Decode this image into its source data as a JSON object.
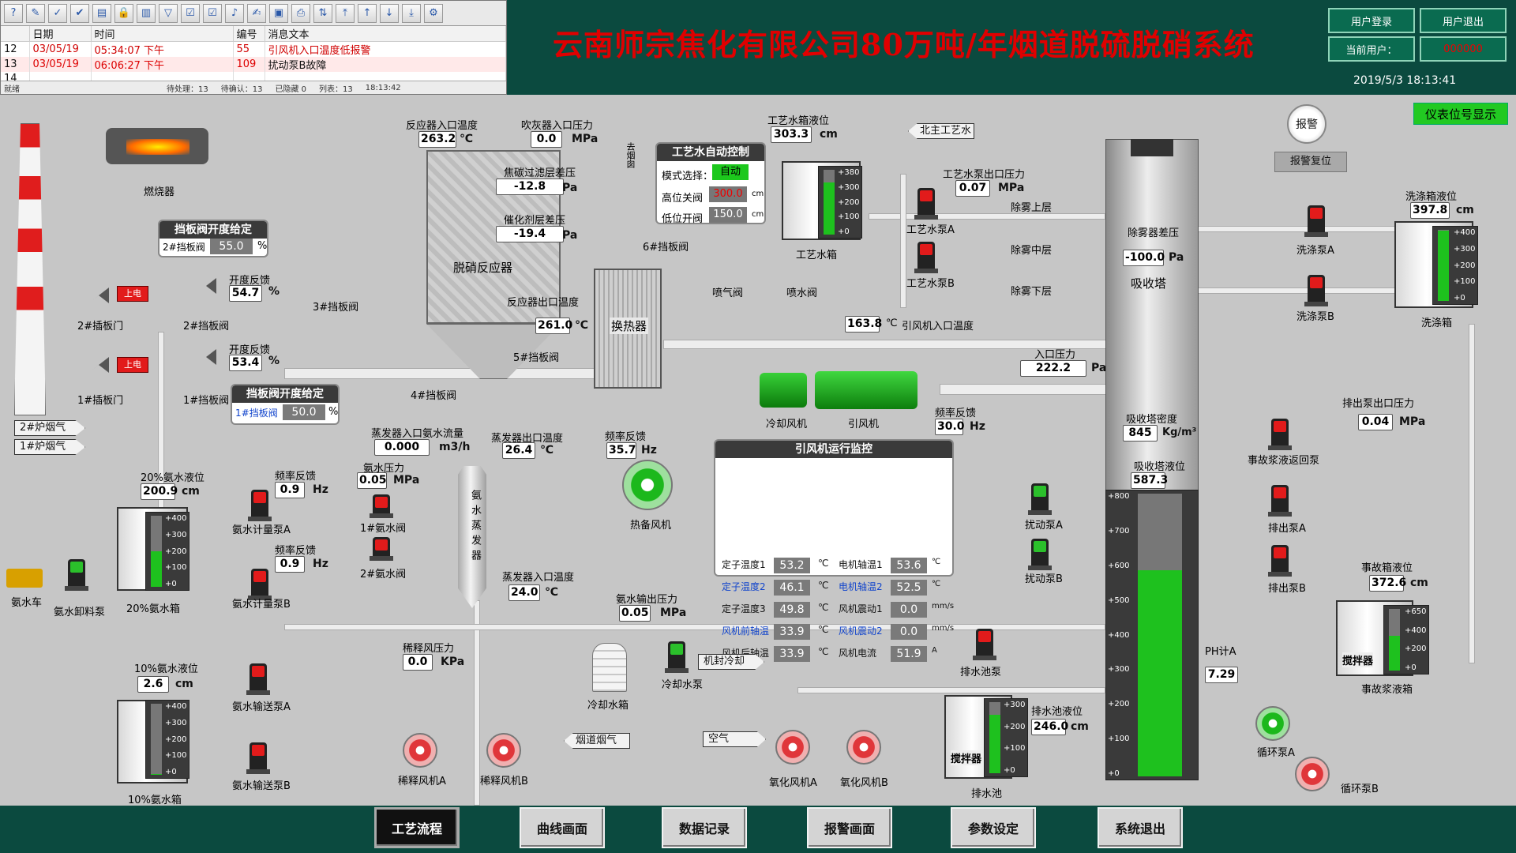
{
  "app": {
    "title": "云南师宗焦化有限公司80万吨/年烟道脱硫脱硝系统",
    "datetime": "2019/5/3 18:13:41",
    "login_label": "用户登录",
    "logout_label": "用户退出",
    "current_user_label": "当前用户：",
    "current_user_value": "000000",
    "instrument_btn": "仪表位号显示",
    "alarm_btn": "报警",
    "alarm_reset_btn": "报警复位"
  },
  "alarm_panel": {
    "columns": [
      "日期",
      "时间",
      "编号",
      "消息文本"
    ],
    "rows": [
      {
        "idx": "12",
        "date": "03/05/19",
        "time": "05:34:07 下午",
        "code": "55",
        "text": "引风机入口温度低报警"
      },
      {
        "idx": "13",
        "date": "03/05/19",
        "time": "06:06:27 下午",
        "code": "109",
        "text": "扰动泵B故障"
      },
      {
        "idx": "14",
        "date": "",
        "time": "",
        "code": "",
        "text": ""
      }
    ],
    "status_ready": "就绪",
    "status_pending": "待处理：13",
    "status_confirm": "待确认：13",
    "status_hidden": "已隐藏 0",
    "status_list": "列表：13",
    "status_time": "18:13:42"
  },
  "labels": {
    "burner": "燃烧器",
    "damper_panel_title": "挡板阀开度给定",
    "damper2_label": "2#挡板阀",
    "damper2_value": "55.0",
    "damper1_label": "1#挡板阀",
    "damper1_value": "50.0",
    "percent": "%",
    "open_fb": "开度反馈",
    "open_fb_2": "54.7",
    "open_fb_1": "53.4",
    "power_on": "上电",
    "valve2": "2#插板门",
    "valve1": "1#插板门",
    "damper2": "2#挡板阀",
    "damper1": "1#挡板阀",
    "flue2": "2#炉烟气",
    "flue1": "1#炉烟气",
    "reactor_in_temp": "反应器入口温度",
    "reactor_in_temp_val": "263.2",
    "blower_in_press": "吹灰器入口压力",
    "blower_in_press_val": "0.0",
    "coke_filter": "焦碳过滤层差压",
    "coke_filter_val": "-12.8",
    "catalyst": "催化剂层差压",
    "catalyst_val": "-19.4",
    "denox": "脱硝反应器",
    "reactor_out_temp": "反应器出口温度",
    "reactor_out_temp_val": "261.0",
    "damper3": "3#挡板阀",
    "damper4": "4#挡板阀",
    "damper5": "5#挡板阀",
    "damper6": "6#挡板阀",
    "chimney_label": "去烟囱",
    "heat_exchanger": "换热器",
    "water_ctrl_title": "工艺水自动控制",
    "mode_label": "模式选择：",
    "mode_value": "自动",
    "high_close": "高位关阀",
    "high_close_val": "300.0",
    "low_open": "低位开阀",
    "low_open_val": "150.0",
    "cm": "cm",
    "water_tank_level": "工艺水箱液位",
    "water_tank_level_val": "303.3",
    "water_tank": "工艺水箱",
    "north_water": "北主工艺水",
    "pump_out_press": "工艺水泵出口压力",
    "pump_out_press_val": "0.07",
    "pumpA": "工艺水泵A",
    "pumpB": "工艺水泵B",
    "mist_upper": "除雾上层",
    "mist_mid": "除雾中层",
    "mist_low": "除雾下层",
    "spray_valve": "喷气阀",
    "spray_water": "喷水阀",
    "fan_in_temp": "引风机入口温度",
    "fan_in_temp_val": "163.8",
    "cool_fan": "冷却风机",
    "induced_fan": "引风机",
    "freq_fb": "频率反馈",
    "freq_fb_val": "30.0",
    "hz": "Hz",
    "in_press": "入口压力",
    "in_press_val": "222.2",
    "pa": "Pa",
    "mpa": "MPa",
    "kpa": "KPa",
    "c": "℃",
    "absorber": "吸收塔",
    "demister_dp": "除雾器差压",
    "demister_dp_val": "-100.0",
    "absorber_density": "吸收塔密度",
    "absorber_density_val": "845",
    "density_unit": "Kg/m³",
    "absorber_level": "吸收塔液位",
    "absorber_level_val": "587.3",
    "wash_tank_level": "洗涤箱液位",
    "wash_tank_level_val": "397.8",
    "wash_pumpA": "洗涤泵A",
    "wash_pumpB": "洗涤泵B",
    "wash_tank": "洗涤箱",
    "discharge_press": "排出泵出口压力",
    "discharge_press_val": "0.04",
    "accident_return": "事故浆液返回泵",
    "dischargeA": "排出泵A",
    "dischargeB": "排出泵B",
    "accident_tank_level": "事故箱液位",
    "accident_tank_level_val": "372.6",
    "accident_tank": "事故浆液箱",
    "agitator": "搅拌器",
    "stirA": "扰动泵A",
    "stirB": "扰动泵B",
    "ph": "PH计A",
    "ph_val": "7.29",
    "circA": "循环泵A",
    "circB": "循环泵B",
    "sump_pump": "排水池泵",
    "sump_level": "排水池液位",
    "sump_level_val": "246.0",
    "sump": "排水池",
    "evap_flow": "蒸发器入口氨水流量",
    "evap_flow_val": "0.000",
    "m3h": "m3/h",
    "evap_out_temp": "蒸发器出口温度",
    "evap_out_temp_val": "26.4",
    "freq_fb2": "频率反馈",
    "freq_fb2_val": "35.7",
    "heat_fan": "热备风机",
    "nh3_press": "氨水压力",
    "nh3_press_val": "0.05",
    "nh3_valve1": "1#氨水阀",
    "nh3_valve2": "2#氨水阀",
    "evaporator": "氨水蒸发器",
    "evap_in_temp": "蒸发器入口温度",
    "evap_in_temp_val": "24.0",
    "nh3_out_press": "氨水输出压力",
    "nh3_out_press_val": "0.05",
    "t20_level": "20%氨水液位",
    "t20_level_val": "200.9",
    "t20_tank": "20%氨水箱",
    "nh3_truck": "氨水车",
    "nh3_unload": "氨水卸料泵",
    "meterA": "氨水计量泵A",
    "meterB": "氨水计量泵B",
    "meter_freqA": "0.9",
    "meter_freqB": "0.9",
    "t10_level": "10%氨水液位",
    "t10_level_val": "2.6",
    "t10_tank": "10%氨水箱",
    "transA": "氨水输送泵A",
    "transB": "氨水输送泵B",
    "dilute_press": "稀释风压力",
    "dilute_press_val": "0.0",
    "cool_tank": "冷却水箱",
    "cool_pump": "冷却水泵",
    "machine_cool": "机封冷却",
    "flue_gas": "烟道烟气",
    "air": "空气",
    "diluteA": "稀释风机A",
    "diluteB": "稀释风机B",
    "oxidA": "氧化风机A",
    "oxidB": "氧化风机B"
  },
  "monitor": {
    "title": "引风机运行监控",
    "rows": [
      {
        "l1": "定子温度1",
        "v1": "53.2",
        "u1": "℃",
        "l2": "电机轴温1",
        "v2": "53.6",
        "u2": "℃"
      },
      {
        "l1": "定子温度2",
        "v1": "46.1",
        "u1": "℃",
        "l2": "电机轴温2",
        "v2": "52.5",
        "u2": "℃"
      },
      {
        "l1": "定子温度3",
        "v1": "49.8",
        "u1": "℃",
        "l2": "风机震动1",
        "v2": "0.0",
        "u2": "mm/s"
      },
      {
        "l1": "风机前轴温",
        "v1": "33.9",
        "u1": "℃",
        "l2": "风机震动2",
        "v2": "0.0",
        "u2": "mm/s"
      },
      {
        "l1": "风机后轴温",
        "v1": "33.9",
        "u1": "℃",
        "l2": "风机电流",
        "v2": "51.9",
        "u2": "A"
      }
    ]
  },
  "scales": {
    "water_tank": [
      "+380",
      "+300",
      "+200",
      "+100",
      "+0"
    ],
    "wash_tank": [
      "+400",
      "+300",
      "+200",
      "+100",
      "+0"
    ],
    "accident_tank": [
      "+650",
      "+400",
      "+200",
      "+0"
    ],
    "sump": [
      "+300",
      "+200",
      "+100",
      "+0"
    ],
    "t20": [
      "+400",
      "+300",
      "+200",
      "+100",
      "+0"
    ],
    "t10": [
      "+400",
      "+300",
      "+200",
      "+100",
      "+0"
    ],
    "absorber": [
      "+800",
      "+700",
      "+600",
      "+500",
      "+400",
      "+300",
      "+200",
      "+100",
      "+0"
    ]
  },
  "levels": {
    "water_tank": 0.8,
    "wash_tank": 0.99,
    "accident_tank": 0.57,
    "sump": 0.82,
    "t20": 0.5,
    "t10": 0.01,
    "absorber": 0.73
  },
  "nav": [
    "工艺流程",
    "曲线画面",
    "数据记录",
    "报警画面",
    "参数设定",
    "系统退出"
  ]
}
